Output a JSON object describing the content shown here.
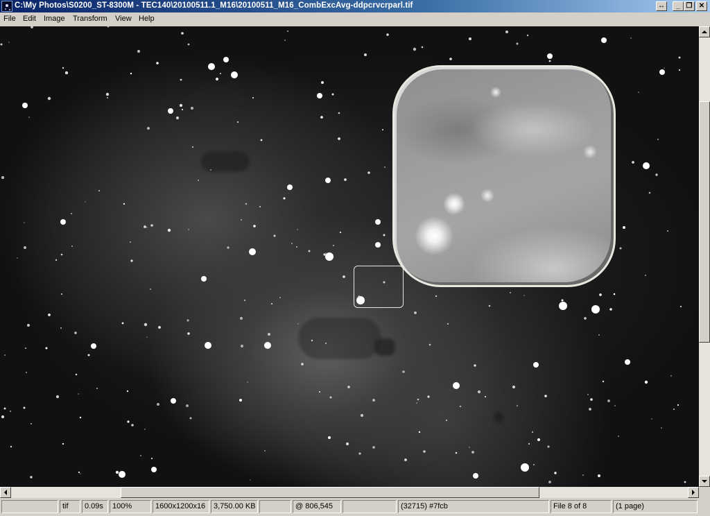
{
  "window": {
    "title": "C:\\My Photos\\S0200_ST-8300M - TEC140\\20100511.1_M16\\20100511_M16_CombExcAvg-ddpcrvcrparl.tif",
    "controls": {
      "restore_glyph": "↔",
      "minimize_glyph": "_",
      "maximize_glyph": "❐",
      "close_glyph": "✕"
    }
  },
  "menu": [
    "File",
    "Edit",
    "Image",
    "Transform",
    "View",
    "Help"
  ],
  "status": {
    "format": "tif",
    "load_time": "0.09s",
    "zoom": "100%",
    "dimensions": "1600x1200x16",
    "file_size": "3,750.00 KB",
    "cursor_pos": "@ 806,545",
    "pixel_value": "(32715) #7fcb",
    "file_index": "File 8 of 8",
    "pages": "(1 page)"
  },
  "colors": {
    "titlebar_start": "#0a246a",
    "titlebar_end": "#a6caf0",
    "chrome": "#d4d0c8"
  },
  "icons": {
    "app": "app-icon",
    "restore": "restore-icon",
    "minimize": "minimize-icon",
    "maximize": "maximize-icon",
    "close": "close-icon"
  }
}
